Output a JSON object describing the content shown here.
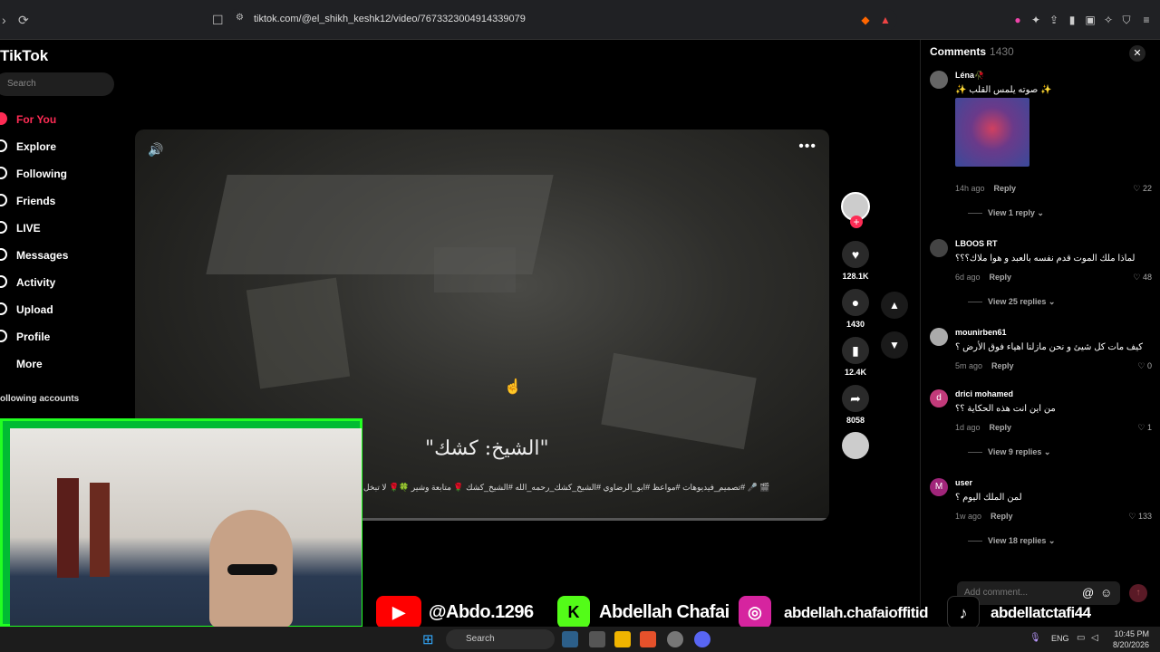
{
  "browser": {
    "url": "tiktok.com/@el_shikh_keshk12/video/7673323004914339079"
  },
  "sidebar": {
    "logo": "TikTok",
    "search_placeholder": "Search",
    "items": [
      {
        "label": "For You",
        "active": true
      },
      {
        "label": "Explore"
      },
      {
        "label": "Following"
      },
      {
        "label": "Friends"
      },
      {
        "label": "LIVE"
      },
      {
        "label": "Messages"
      },
      {
        "label": "Activity"
      },
      {
        "label": "Upload"
      },
      {
        "label": "Profile"
      },
      {
        "label": "More"
      }
    ],
    "following_accounts": "ollowing accounts"
  },
  "video": {
    "caption": "\"الشيخ: كشك\"",
    "hashtags": "🎬 🎤 #تصميم_فيديوهات #مواعظ #ابو_الرضاوي #الشيخ_كشك_رحمه_الله #الشيخ_كشك 🌹 متابعة وشير 🍀🌹 لا تبخل"
  },
  "actions": {
    "likes": "128.1K",
    "comments": "1430",
    "saves": "12.4K",
    "shares": "8058"
  },
  "comments": {
    "title": "Comments",
    "count": "1430",
    "items": [
      {
        "user": "Léna🥀",
        "text": "✨ صوته يلمس القلب ✨",
        "time": "14h ago",
        "reply": "Reply",
        "likes": "22",
        "view_replies": "View 1 reply"
      },
      {
        "user": "LBOOS RT",
        "text": "لماذا ملك الموت قدم نفسه بالعبد و هوا ملاك؟؟؟",
        "time": "6d ago",
        "reply": "Reply",
        "likes": "48",
        "view_replies": "View 25 replies"
      },
      {
        "user": "mounirben61",
        "text": "كيف مات كل شيئ و نحن مازلنا اهياء فوق الأرض ؟",
        "time": "5m ago",
        "reply": "Reply",
        "likes": "0"
      },
      {
        "user": "drici mohamed",
        "text": "من اين انت هذه الحكاية ؟؟",
        "time": "1d ago",
        "reply": "Reply",
        "likes": "1",
        "view_replies": "View 9 replies",
        "avatar_letter": "d"
      },
      {
        "user": "user",
        "text": "لمن الملك اليوم ؟",
        "time": "1w ago",
        "reply": "Reply",
        "likes": "133",
        "view_replies": "View 18 replies",
        "avatar_letter": "M"
      }
    ],
    "add_placeholder": "Add comment..."
  },
  "banner": {
    "youtube": "@Abdo.1296",
    "kick": "Abdellah Chafai",
    "instagram": "abdellah.chafaioffitid",
    "tiktok": "abdellatctafi44"
  },
  "taskbar": {
    "search": "Search",
    "lang": "ENG",
    "time": "10:45 PM",
    "date": "8/20/2026"
  },
  "colors": {
    "accent": "#fe2c55",
    "webcam_frame": "#22ff22"
  }
}
